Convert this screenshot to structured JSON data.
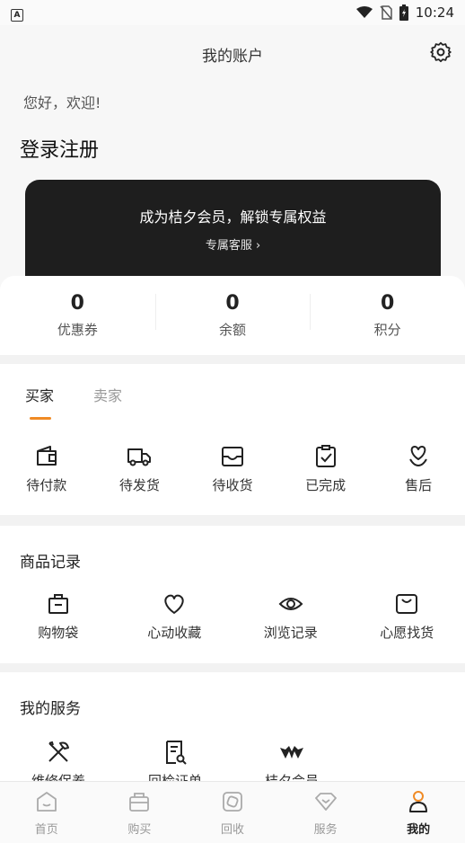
{
  "status": {
    "time": "10:24"
  },
  "header": {
    "title": "我的账户",
    "welcome": "您好，欢迎!",
    "login": "登录注册"
  },
  "member": {
    "title": "成为桔夕会员，解锁专属权益",
    "link": "专属客服 ›"
  },
  "stats": [
    {
      "value": "0",
      "label": "优惠券"
    },
    {
      "value": "0",
      "label": "余额"
    },
    {
      "value": "0",
      "label": "积分"
    }
  ],
  "orders": {
    "tabs": [
      "买家",
      "卖家"
    ],
    "items": [
      {
        "label": "待付款",
        "icon": "wallet-icon"
      },
      {
        "label": "待发货",
        "icon": "truck-icon"
      },
      {
        "label": "待收货",
        "icon": "inbox-icon"
      },
      {
        "label": "已完成",
        "icon": "clipboard-check-icon"
      },
      {
        "label": "售后",
        "icon": "heart-hand-icon"
      }
    ]
  },
  "records": {
    "title": "商品记录",
    "items": [
      {
        "label": "购物袋",
        "icon": "bag-icon"
      },
      {
        "label": "心动收藏",
        "icon": "heart-icon"
      },
      {
        "label": "浏览记录",
        "icon": "eye-icon"
      },
      {
        "label": "心愿找货",
        "icon": "box-icon"
      }
    ]
  },
  "services": {
    "title": "我的服务",
    "items": [
      {
        "label": "维修保养",
        "icon": "tools-icon"
      },
      {
        "label": "回检证单",
        "icon": "document-search-icon"
      },
      {
        "label": "桔夕会员",
        "icon": "crown-icon"
      }
    ]
  },
  "tabbar": [
    {
      "label": "首页",
      "icon": "home-icon",
      "active": false
    },
    {
      "label": "购买",
      "icon": "basket-icon",
      "active": false
    },
    {
      "label": "回收",
      "icon": "recycle-icon",
      "active": false
    },
    {
      "label": "服务",
      "icon": "diamond-icon",
      "active": false
    },
    {
      "label": "我的",
      "icon": "person-icon",
      "active": true
    }
  ],
  "colors": {
    "accent": "#f08a24",
    "card_dark": "#1e1e1e"
  }
}
